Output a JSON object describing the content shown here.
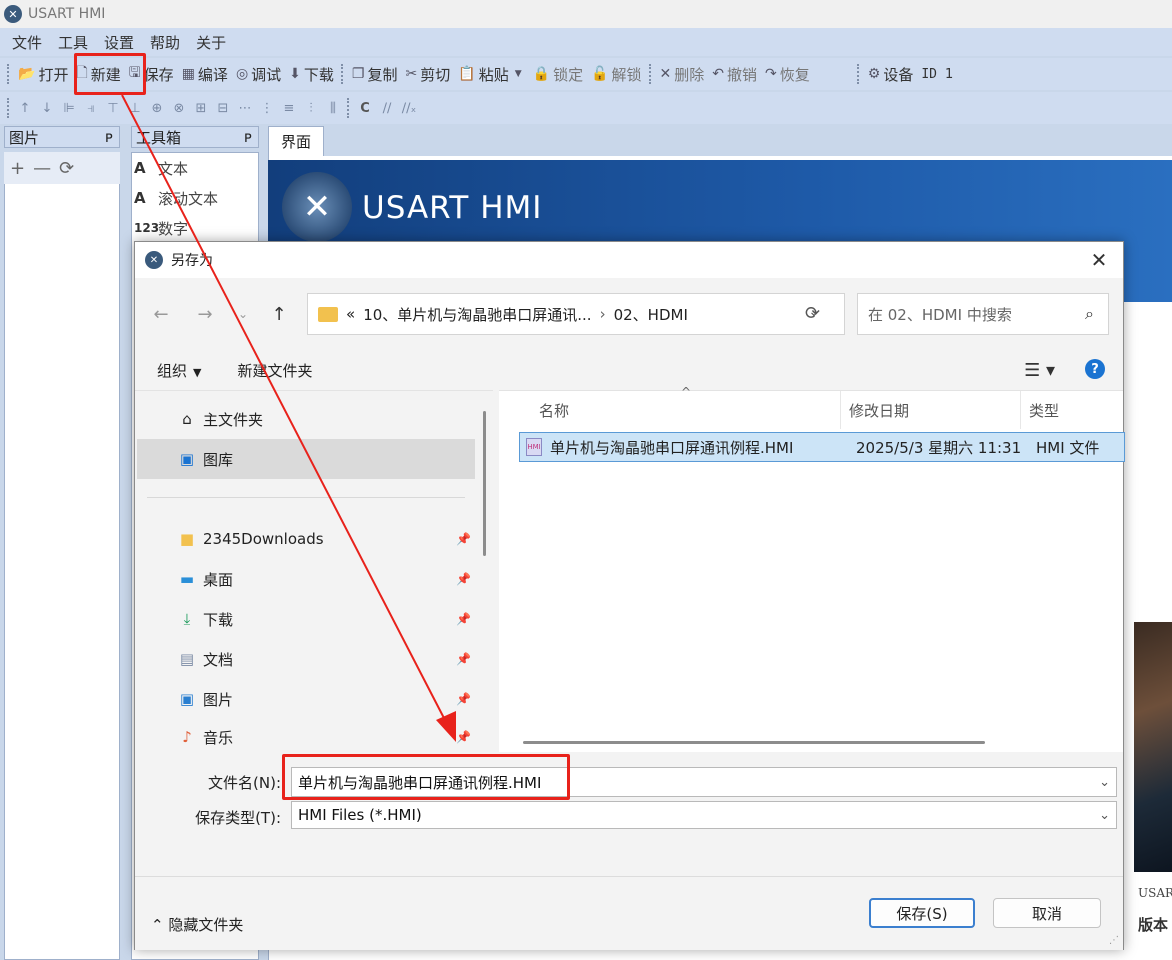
{
  "app": {
    "title": "USART HMI",
    "menu": [
      "文件",
      "工具",
      "设置",
      "帮助",
      "关于"
    ],
    "toolbar": [
      {
        "name": "open",
        "icon": "open-folder-icon",
        "label": "打开"
      },
      {
        "name": "new",
        "icon": "new-file-icon",
        "label": "新建"
      },
      {
        "name": "save",
        "icon": "save-icon",
        "label": "保存"
      },
      {
        "name": "compile",
        "icon": "compile-icon",
        "label": "编译"
      },
      {
        "name": "debug",
        "icon": "debug-icon",
        "label": "调试"
      },
      {
        "name": "download",
        "icon": "download-icon",
        "label": "下载"
      },
      {
        "name": "copy",
        "icon": "copy-icon",
        "label": "复制"
      },
      {
        "name": "cut",
        "icon": "cut-icon",
        "label": "剪切"
      },
      {
        "name": "paste",
        "icon": "paste-icon",
        "label": "粘贴"
      },
      {
        "name": "lock",
        "icon": "lock-icon",
        "label": "锁定"
      },
      {
        "name": "unlock",
        "icon": "unlock-icon",
        "label": "解锁"
      },
      {
        "name": "delete",
        "icon": "delete-icon",
        "label": "删除"
      },
      {
        "name": "undo",
        "icon": "undo-icon",
        "label": "撤销"
      },
      {
        "name": "redo",
        "icon": "redo-icon",
        "label": "恢复"
      },
      {
        "name": "device",
        "icon": "gear-icon",
        "label": "设备"
      },
      {
        "name": "id",
        "icon": "",
        "label": "ID"
      },
      {
        "name": "id-value",
        "icon": "",
        "label": "1"
      }
    ],
    "panels": {
      "pictures": "图片",
      "toolbox": "工具箱",
      "canvas_tab": "界面",
      "pin": "ᴘ"
    },
    "toolbox_items": [
      {
        "icon": "A",
        "label": "文本"
      },
      {
        "icon": "A",
        "label": "滚动文本"
      },
      {
        "icon": "123",
        "label": "数字"
      }
    ],
    "banner_text": "USART HMI",
    "right_labels": [
      "USAR",
      "版本"
    ]
  },
  "dialog": {
    "title": "另存为",
    "address": {
      "prefix": "«",
      "segment1": "10、单片机与淘晶驰串口屏通讯...",
      "separator": "›",
      "segment2": "02、HDMI"
    },
    "search_placeholder": "在 02、HDMI 中搜索",
    "commands": {
      "organize": "组织",
      "new_folder": "新建文件夹"
    },
    "nav_items": [
      {
        "name": "home",
        "icon": "home-icon",
        "label": "主文件夹",
        "pinned": false
      },
      {
        "name": "gallery",
        "icon": "gallery-icon",
        "label": "图库",
        "pinned": false,
        "selected": true
      },
      {
        "name": "downloads-2345",
        "icon": "folder-icon",
        "label": "2345Downloads",
        "pinned": true
      },
      {
        "name": "desktop",
        "icon": "desktop-icon",
        "label": "桌面",
        "pinned": true
      },
      {
        "name": "downloads",
        "icon": "download-icon",
        "label": "下载",
        "pinned": true
      },
      {
        "name": "documents",
        "icon": "document-icon",
        "label": "文档",
        "pinned": true
      },
      {
        "name": "pictures",
        "icon": "picture-icon",
        "label": "图片",
        "pinned": true
      },
      {
        "name": "music",
        "icon": "music-icon",
        "label": "音乐",
        "pinned": true
      }
    ],
    "columns": {
      "name": "名称",
      "modified": "修改日期",
      "type": "类型"
    },
    "files": [
      {
        "name": "单片机与淘晶驰串口屏通讯例程.HMI",
        "modified": "2025/5/3 星期六 11:31",
        "type": "HMI 文件"
      }
    ],
    "file_name_label": "文件名(N):",
    "file_name_value": "单片机与淘晶驰串口屏通讯例程.HMI",
    "file_type_label": "保存类型(T):",
    "file_type_value": "HMI Files (*.HMI)",
    "hide_folders": "隐藏文件夹",
    "save_button": "保存(S)",
    "cancel_button": "取消"
  },
  "colors": {
    "annotation": "#e8221b",
    "accent": "#1a73d1",
    "selection": "#cce4f7"
  }
}
